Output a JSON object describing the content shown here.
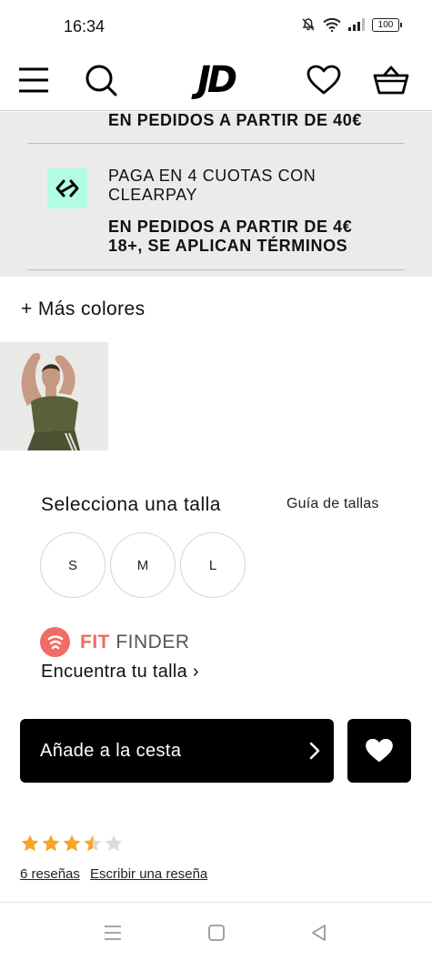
{
  "status_bar": {
    "time": "16:34",
    "battery": "100"
  },
  "header": {
    "logo_text": "JD",
    "icons": [
      "menu-icon",
      "search-icon",
      "heart-icon",
      "basket-icon"
    ]
  },
  "payment_info": {
    "line1": "EN PEDIDOS A PARTIR DE 40€",
    "clearpay_title": "PAGA EN 4 CUOTAS CON CLEARPAY",
    "clearpay_terms_1": "EN PEDIDOS A PARTIR DE 4€",
    "clearpay_terms_2": "18+, SE APLICAN TÉRMINOS",
    "clearpay_color": "#b2fce4"
  },
  "colors": {
    "more_label": "+ Más colores"
  },
  "sizes": {
    "title": "Selecciona una talla",
    "guide_label": "Guía de tallas",
    "options": [
      "S",
      "M",
      "L"
    ]
  },
  "fit_finder": {
    "brand_fit": "FIT",
    "brand_finder": "FINDER",
    "link": "Encuentra tu talla ›",
    "accent": "#f16c64"
  },
  "actions": {
    "add_to_cart": "Añade a la cesta"
  },
  "reviews": {
    "rating": 3.5,
    "max": 5,
    "count_label": "6 reseñas",
    "write_label": "Escribir una reseña",
    "star_color": "#f5a623"
  },
  "nav_bar": {
    "icons": [
      "recents-icon",
      "home-icon",
      "back-icon"
    ]
  }
}
